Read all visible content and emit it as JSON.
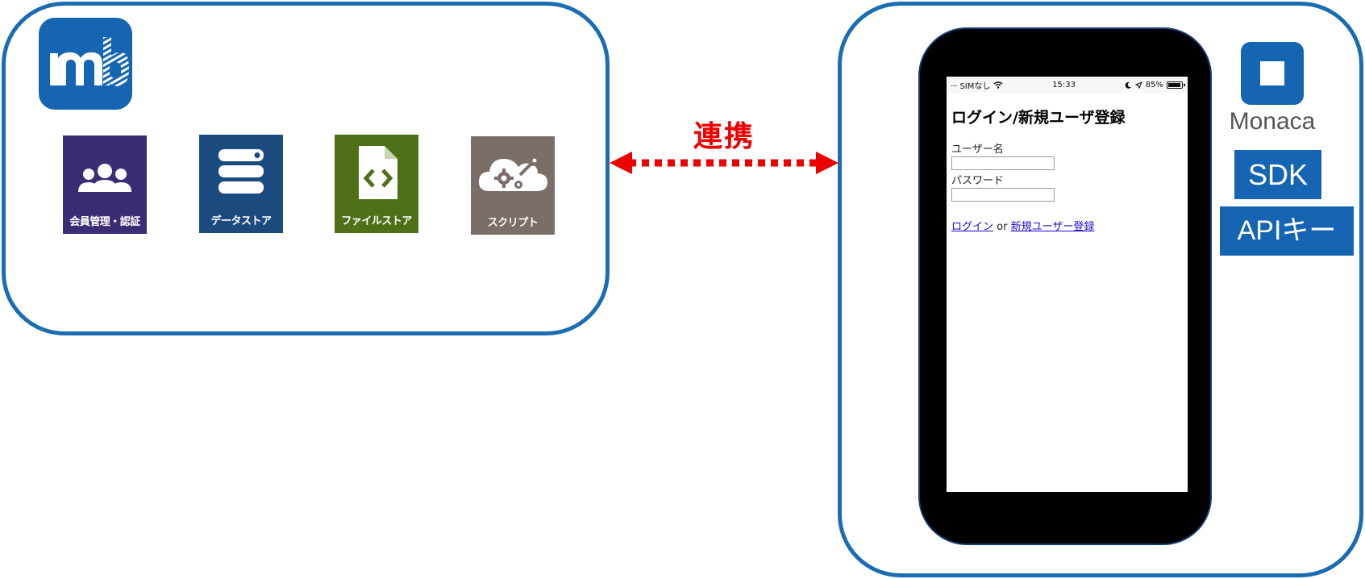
{
  "backend": {
    "logo": {
      "icon": "mbaas-logo-icon",
      "text": "mb",
      "color": "#1565b2"
    },
    "services": [
      {
        "label": "会員管理・認証",
        "icon": "users-icon",
        "color": "#3d2c73"
      },
      {
        "label": "データストア",
        "icon": "database-icon",
        "color": "#1b4b7e"
      },
      {
        "label": "ファイルストア",
        "icon": "code-file-icon",
        "color": "#4e7118"
      },
      {
        "label": "スクリプト",
        "icon": "cloud-gear-icon",
        "color": "#7a6e69"
      }
    ]
  },
  "connection": {
    "label": "連携",
    "color": "#ee0000"
  },
  "app": {
    "statusbar": {
      "carrier": "SIMなし",
      "time": "15:33",
      "battery_text": "85%",
      "battery_level": 0.85
    },
    "screen": {
      "title": "ログイン/新規ユーザ登録",
      "username_label": "ユーザー名",
      "username_value": "",
      "password_label": "パスワード",
      "password_value": "",
      "login_link": "ログイン",
      "or_text": "or",
      "signup_link": "新規ユーザー登録"
    },
    "monaca": {
      "icon": "monaca-logo-icon",
      "name": "Monaca"
    },
    "badges": {
      "sdk": "SDK",
      "apikey": "APIキー"
    }
  },
  "colors": {
    "panel_border": "#1a6cb3",
    "badge": "#1565b2",
    "arrow": "#ee0000"
  }
}
